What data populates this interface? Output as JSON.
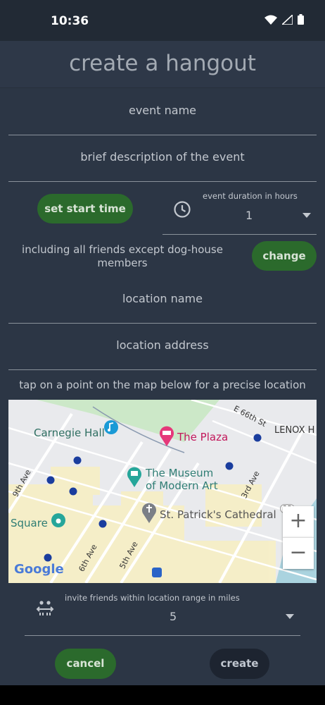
{
  "status": {
    "time": "10:36"
  },
  "header": {
    "title": "create a hangout"
  },
  "form": {
    "event_name_placeholder": "event name",
    "description_placeholder": "brief description of the event",
    "start_time_button": "set start time",
    "duration_label": "event duration in hours",
    "duration_value": "1",
    "friends_text": "including all friends except dog-house members",
    "change_button": "change",
    "location_name_placeholder": "location name",
    "location_address_placeholder": "location address",
    "map_hint": "tap on a point on the map below for a precise location",
    "range_label": "invite friends within location range in miles",
    "range_value": "5",
    "cancel_button": "cancel",
    "create_button": "create"
  },
  "map": {
    "labels": {
      "carnegie": "Carnegie Hall",
      "plaza": "The Plaza",
      "moma_1": "The Museum",
      "moma_2": "of Modern Art",
      "stpat": "St. Patrick's Cathedral",
      "square": "Square",
      "e66": "E 66th St",
      "lenox": "LENOX H",
      "ave9": "9th Ave",
      "ave6": "6th Ave",
      "ave5": "5th Ave",
      "ave3": "3rd Ave",
      "google": "Google",
      "route": "25"
    },
    "zoom_in": "+",
    "zoom_out": "−"
  },
  "colors": {
    "accent_green": "#2b6a2c",
    "background": "#2c3645",
    "header": "#2e3848"
  },
  "icons": [
    "wifi-icon",
    "signal-icon",
    "battery-icon",
    "clock-icon",
    "range-icon",
    "dropdown-caret-icon",
    "music-icon",
    "hotel-pin-icon",
    "museum-pin-icon",
    "church-pin-icon",
    "camera-pin-icon",
    "transit-icon"
  ]
}
